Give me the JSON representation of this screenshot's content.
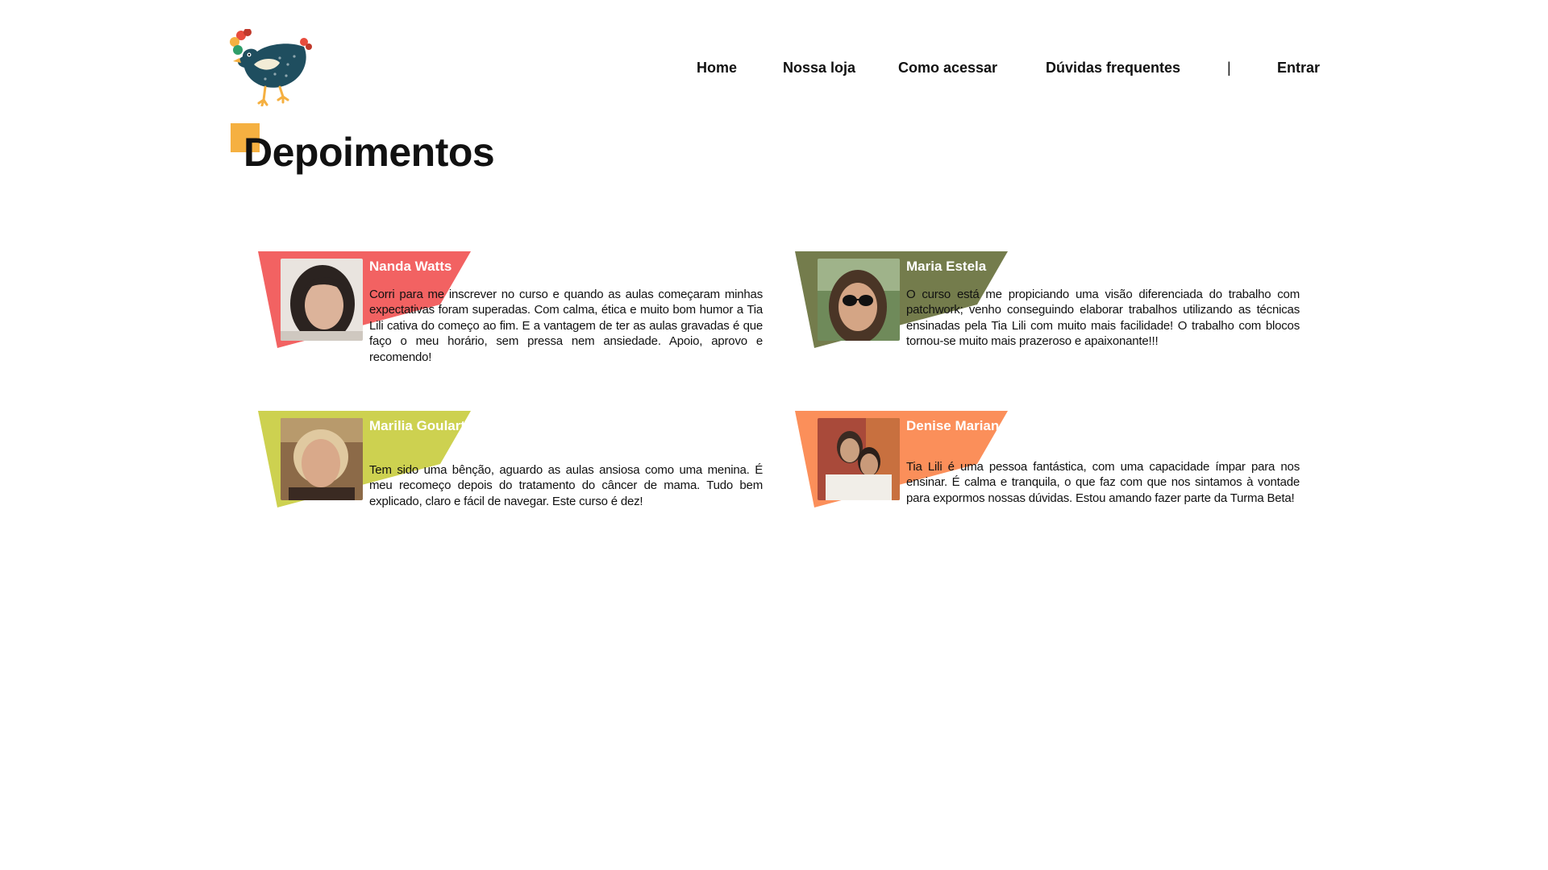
{
  "nav": {
    "items": [
      {
        "label": "Home"
      },
      {
        "label": "Nossa loja"
      },
      {
        "label": "Como acessar"
      },
      {
        "label": "Dúvidas frequentes"
      }
    ],
    "separator": "|",
    "login_label": "Entrar"
  },
  "page_title": "Depoimentos",
  "colors": {
    "accent_square": "#f5b041",
    "card_red": "#f26262",
    "card_olive": "#747c4c",
    "card_lime": "#cdd150",
    "card_orange": "#fb8f5a",
    "logo_body": "#1f4e5f"
  },
  "testimonials": [
    {
      "name": "Nanda Watts",
      "text": "Corri para me inscrever no curso e quando as aulas começaram minhas expectativas foram superadas. Com calma, ética e muito bom humor a Tia Lili cativa do começo ao fim. E a vantagem de ter as aulas gravadas é que faço o meu horário, sem pressa nem ansiedade. Apoio, aprovo e recomendo!"
    },
    {
      "name": "Maria Estela",
      "text": "O curso está me propiciando uma visão diferenciada do trabalho com patchwork; venho conseguindo elaborar trabalhos utilizando as técnicas ensinadas pela Tia Lili com muito mais facilidade! O trabalho com blocos tornou-se muito mais prazeroso e apaixonante!!!"
    },
    {
      "name": "Marilia Goulart",
      "text": "Tem sido uma bênção, aguardo as aulas ansiosa como uma menina. É meu recomeço depois do tratamento do câncer de mama. Tudo bem explicado, claro e fácil de navegar. Este curso é dez!"
    },
    {
      "name": "Denise Mariano",
      "text": "Tia Lili é uma pessoa fantástica, com uma capacidade ímpar para nos ensinar. É calma e tranquila, o que faz com que nos sintamos à vontade para expormos nossas dúvidas. Estou amando fazer parte da Turma Beta!"
    }
  ]
}
